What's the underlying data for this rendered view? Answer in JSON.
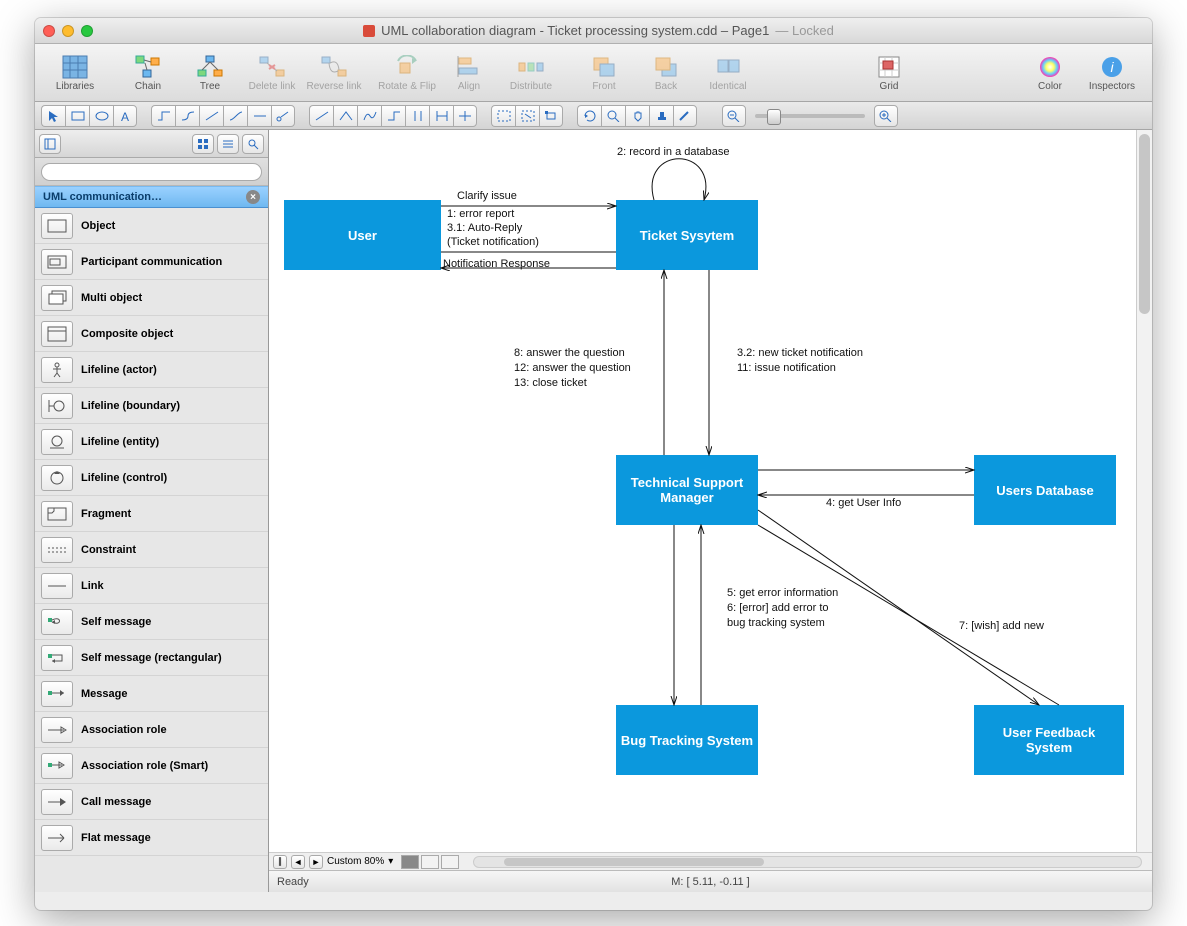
{
  "title": "UML collaboration diagram - Ticket processing system.cdd – Page1",
  "locked": "— Locked",
  "toolbar": [
    {
      "id": "libraries",
      "label": "Libraries",
      "icon": "grid-icon",
      "dis": false
    },
    {
      "id": "chain",
      "label": "Chain",
      "icon": "chain-icon",
      "dis": false
    },
    {
      "id": "tree",
      "label": "Tree",
      "icon": "tree-icon",
      "dis": false
    },
    {
      "id": "deletelink",
      "label": "Delete link",
      "icon": "delete-link-icon",
      "dis": true
    },
    {
      "id": "reverselink",
      "label": "Reverse link",
      "icon": "reverse-link-icon",
      "dis": true
    },
    {
      "id": "rotateflip",
      "label": "Rotate & Flip",
      "icon": "rotate-icon",
      "dis": true
    },
    {
      "id": "align",
      "label": "Align",
      "icon": "align-icon",
      "dis": true
    },
    {
      "id": "distribute",
      "label": "Distribute",
      "icon": "distribute-icon",
      "dis": true
    },
    {
      "id": "front",
      "label": "Front",
      "icon": "front-icon",
      "dis": true
    },
    {
      "id": "back",
      "label": "Back",
      "icon": "back-icon",
      "dis": true
    },
    {
      "id": "identical",
      "label": "Identical",
      "icon": "identical-icon",
      "dis": true
    },
    {
      "id": "grid",
      "label": "Grid",
      "icon": "grid2-icon",
      "dis": false
    },
    {
      "id": "color",
      "label": "Color",
      "icon": "color-icon",
      "dis": false
    },
    {
      "id": "inspectors",
      "label": "Inspectors",
      "icon": "info-icon",
      "dis": false
    }
  ],
  "sidebar": {
    "title": "UML communication…",
    "search_placeholder": "",
    "items": [
      "Object",
      "Participant communication",
      "Multi object",
      "Composite object",
      "Lifeline (actor)",
      "Lifeline (boundary)",
      "Lifeline (entity)",
      "Lifeline (control)",
      "Fragment",
      "Constraint",
      "Link",
      "Self message",
      "Self message (rectangular)",
      "Message",
      "Association role",
      "Association role (Smart)",
      "Call message",
      "Flat message"
    ]
  },
  "diagram": {
    "nodes": {
      "user": "User",
      "ticket": "Ticket Sysytem",
      "tsm": "Technical Support Manager",
      "usersdb": "Users Database",
      "bug": "Bug Tracking System",
      "ufs": "User Feedback System"
    },
    "labels": {
      "clarify": "Clarify issue",
      "l1": "1: error report",
      "l31": "3.1: Auto-Reply",
      "l31b": "(Ticket notification)",
      "notif": "Notification Response",
      "self": "2: record in a database",
      "l8": "8: answer the question",
      "l12": "12: answer the question",
      "l13": "13: close ticket",
      "l32": "3.2: new ticket notification",
      "l11": "11: issue notification",
      "l4": "4: get User Info",
      "l5": "5: get error information",
      "l6": "6: [error] add error to",
      "l6b": "    bug tracking system",
      "l7": "7: [wish] add new"
    }
  },
  "zoom": "Custom 80%",
  "status": {
    "left": "Ready",
    "center": "M: [ 5.11, -0.11 ]"
  }
}
